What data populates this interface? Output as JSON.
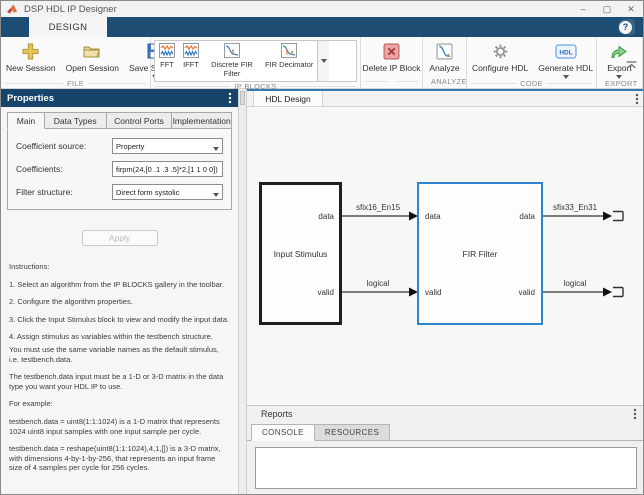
{
  "colors": {
    "ribbon_navy": "#1d4d72",
    "panel_header_navy": "#17446b",
    "block_border_blue": "#2e86d2",
    "doc_accent_blue": "#2e7bb8",
    "delete_red": "#e89a9a",
    "export_green": "#4caf50",
    "save_blue": "#3b77bf",
    "new_session_gold": "#e4c45a"
  },
  "window": {
    "title": "DSP HDL IP Designer",
    "minimize": "–",
    "maximize": "▢",
    "close": "✕"
  },
  "ribbon": {
    "design_tab": "DESIGN",
    "help": "?"
  },
  "toolstrip": {
    "file": {
      "footer": "FILE",
      "new_session": "New Session",
      "open_session": "Open Session",
      "save_session": "Save Session"
    },
    "ip_blocks": {
      "footer": "IP BLOCKS",
      "items": [
        {
          "label": "FFT"
        },
        {
          "label": "IFFT"
        },
        {
          "label": "Discrete FIR Filter"
        },
        {
          "label": "FIR Decimator"
        }
      ]
    },
    "delete_ip_block": "Delete IP Block",
    "analyze": {
      "footer": "ANALYZE",
      "label": "Analyze"
    },
    "code": {
      "footer": "CODE",
      "configure_hdl": "Configure HDL",
      "generate_hdl": "Generate HDL",
      "hdl_badge": "HDL"
    },
    "export": {
      "footer": "EXPORT",
      "label": "Export"
    }
  },
  "properties": {
    "title": "Properties",
    "tabs": [
      "Main",
      "Data Types",
      "Control Ports",
      "Implementation"
    ],
    "coefficient_source_label": "Coefficient source:",
    "coefficient_source_value": "Property",
    "coefficients_label": "Coefficients:",
    "coefficients_value": "firpm(24,[0 .1 .3 .5]*2,[1 1 0 0])",
    "filter_structure_label": "Filter structure:",
    "filter_structure_value": "Direct form systolic",
    "apply": "Apply",
    "instructions": [
      "Instructions:",
      "1. Select an algorithm from the IP BLOCKS gallery in the toolbar.",
      "2. Configure the algorithm properties.",
      "3. Click the Input Stimulus block to view and modify the input data.",
      "4. Assign stimulus as variables within the testbench structure.",
      "You must use the same variable names as the default stimulus, i.e. testbench.data.",
      "The testbench.data input must be a 1-D or 3-D matrix in the data type you want your HDL IP to use.",
      "For example:",
      "testbench.data = uint8(1:1:1024) is a 1-D matrix that represents 1024 uint8 input samples with one input sample per cycle.",
      "testbench.data = reshape(uint8(1:1:1024),4,1,[]) is a 3-D matrix, with dimensions 4-by-1-by-256, that represents an input frame size of 4 samples per cycle for 256 cycles."
    ]
  },
  "design": {
    "tab": "HDL Design",
    "input_stimulus": "Input Stimulus",
    "fir_filter": "FIR Filter",
    "port_data": "data",
    "port_valid": "valid",
    "sig_data_in": "sfix16_En15",
    "sig_valid_in": "logical",
    "sig_data_out": "sfix33_En31",
    "sig_valid_out": "logical"
  },
  "reports": {
    "title": "Reports",
    "tab_console": "CONSOLE",
    "tab_resources": "RESOURCES"
  }
}
